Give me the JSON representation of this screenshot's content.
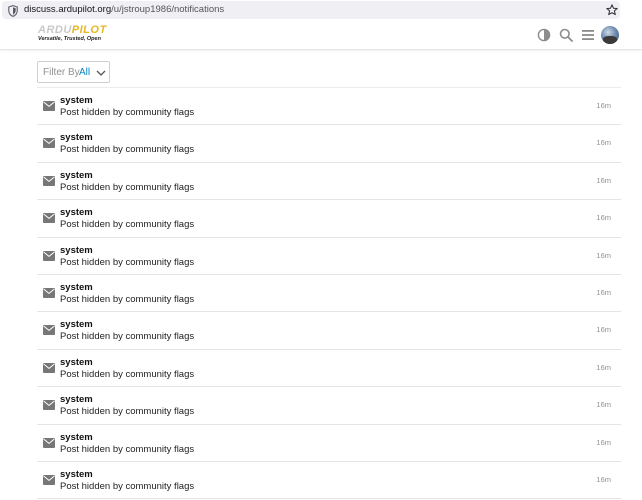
{
  "browser": {
    "url_domain": "discuss.ardupilot.org",
    "url_path": "/u/jstroup1986/notifications",
    "icons": [
      "shield-icon",
      "bookmark-star-icon"
    ]
  },
  "header": {
    "logo_line1_a": "ARDU",
    "logo_line1_b": "PILOT",
    "logo_tagline": "Versatile, Trusted, Open",
    "icons": [
      "theme-toggle-icon",
      "search-icon",
      "hamburger-menu-icon",
      "user-avatar"
    ]
  },
  "filter": {
    "label": "Filter By",
    "value": "All"
  },
  "notifications": [
    {
      "user": "system",
      "text": "Post hidden by community flags",
      "time": "16m"
    },
    {
      "user": "system",
      "text": "Post hidden by community flags",
      "time": "16m"
    },
    {
      "user": "system",
      "text": "Post hidden by community flags",
      "time": "16m"
    },
    {
      "user": "system",
      "text": "Post hidden by community flags",
      "time": "16m"
    },
    {
      "user": "system",
      "text": "Post hidden by community flags",
      "time": "16m"
    },
    {
      "user": "system",
      "text": "Post hidden by community flags",
      "time": "16m"
    },
    {
      "user": "system",
      "text": "Post hidden by community flags",
      "time": "16m"
    },
    {
      "user": "system",
      "text": "Post hidden by community flags",
      "time": "16m"
    },
    {
      "user": "system",
      "text": "Post hidden by community flags",
      "time": "16m"
    },
    {
      "user": "system",
      "text": "Post hidden by community flags",
      "time": "16m"
    },
    {
      "user": "system",
      "text": "Post hidden by community flags",
      "time": "16m"
    }
  ],
  "colors": {
    "accent": "#0a84c0",
    "muted": "#919191",
    "brand_yellow": "#e8b723"
  }
}
